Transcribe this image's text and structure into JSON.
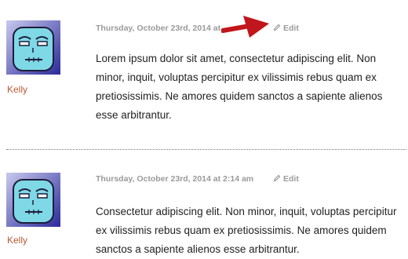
{
  "comments": [
    {
      "author": "Kelly",
      "date": "Thursday, October 23rd, 2014 at",
      "edit_label": "Edit",
      "text": "Lorem ipsum dolor sit amet, consectetur adipiscing elit. Non minor, inquit, voluptas percipitur ex vilissimis rebus quam ex pretiosissimis. Ne amores quidem sanctos a sapiente alienos esse arbitrantur."
    },
    {
      "author": "Kelly",
      "date": "Thursday, October 23rd, 2014 at 2:14 am",
      "edit_label": "Edit",
      "text": "Consectetur adipiscing elit. Non minor, inquit, voluptas percipitur ex vilissimis rebus quam ex pretiosissimis. Ne amores quidem sanctos a sapiente alienos esse arbitrantur."
    }
  ],
  "colors": {
    "author_link": "#b75a34",
    "meta_text": "#9a9a9a",
    "body_text": "#222222",
    "annotation_arrow": "#c0161c"
  },
  "icons": {
    "avatar": "robot-face-avatar-icon",
    "edit": "pencil-icon",
    "annotation": "red-arrow-icon"
  }
}
